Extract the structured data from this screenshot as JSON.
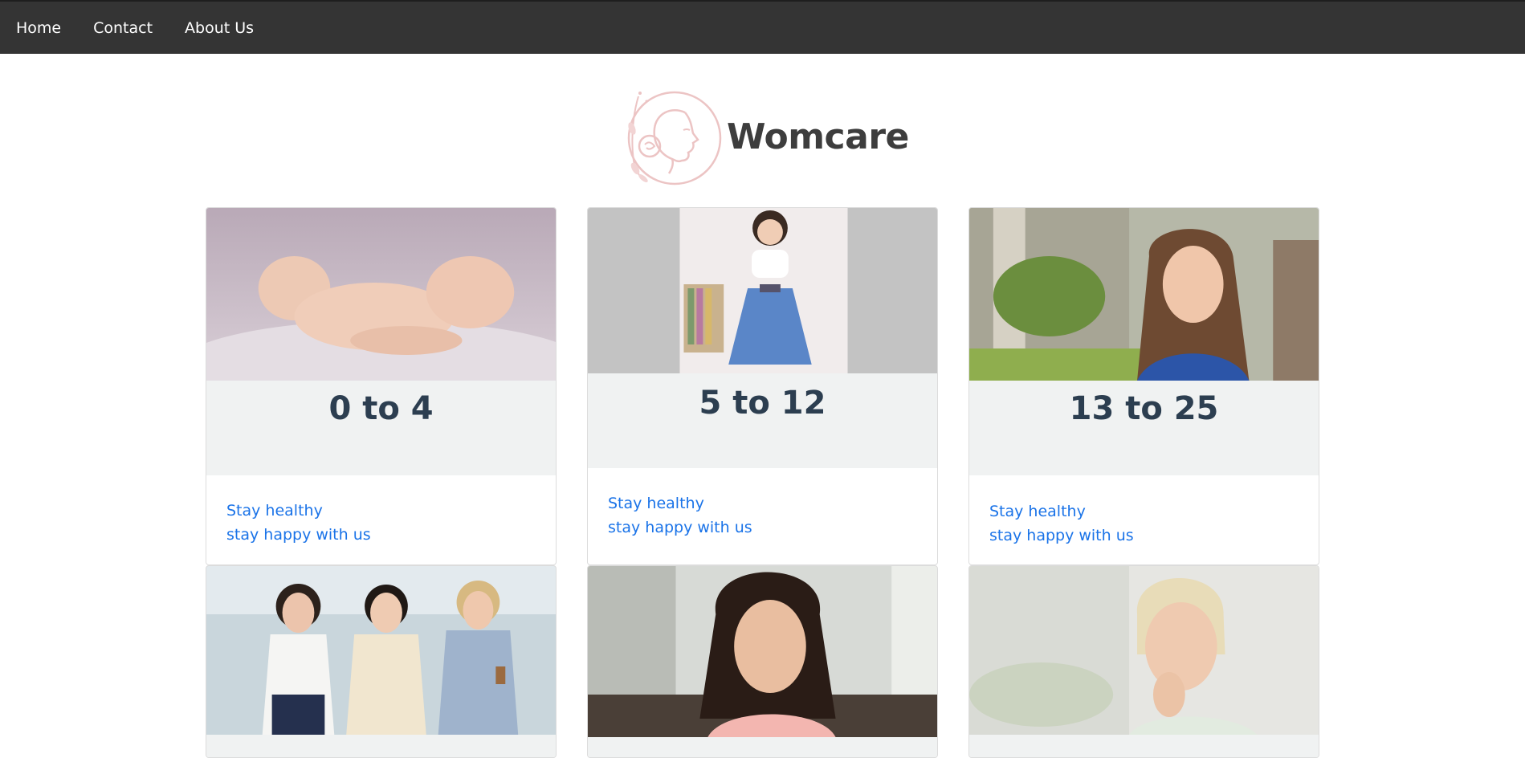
{
  "nav": {
    "items": [
      "Home",
      "Contact",
      "About Us"
    ]
  },
  "brand": {
    "name": "Womcare",
    "logo_color": "#e9b8b8"
  },
  "cards": [
    {
      "title": "0 to 4",
      "line1": "Stay healthy",
      "line2": "stay happy with us",
      "image": "sleeping-baby-photo"
    },
    {
      "title": "5 to 12",
      "line1": "Stay healthy",
      "line2": "stay happy with us",
      "image": "young-girl-in-dress-photo"
    },
    {
      "title": "13 to 25",
      "line1": "Stay healthy",
      "line2": "stay happy with us",
      "image": "smiling-teen-girl-photo"
    },
    {
      "image": "three-women-photo"
    },
    {
      "image": "smiling-woman-photo"
    },
    {
      "image": "smiling-senior-woman-photo"
    }
  ],
  "colors": {
    "navbar": "#343434",
    "title_text": "#2c3e50",
    "link": "#1a73e8",
    "title_bg": "#f0f2f2"
  }
}
